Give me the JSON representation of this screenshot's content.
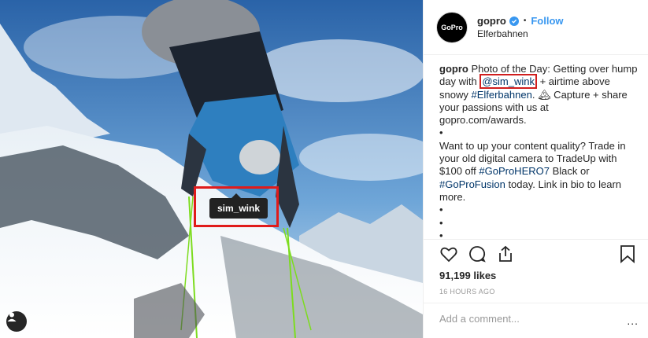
{
  "header": {
    "avatar_text": "GoPro",
    "username": "gopro",
    "dot": "•",
    "follow_label": "Follow",
    "location": "Elferbahnen"
  },
  "caption": {
    "username": "gopro",
    "t1": " Photo of the Day: Getting over hump day with ",
    "mention": "@sim_wink",
    "t2": " + airtime above snowy ",
    "hashtag1": "#Elferbahnen",
    "t3": ". ",
    "emoji": "🏔",
    "t4": " Capture + share your passions with us at gopro.com/awards.",
    "bullet": "•",
    "t5": "Want to up your content quality? Trade in your old digital camera to TradeUp with $100 off ",
    "hashtag2": "#GoProHERO7",
    "t6": " Black or ",
    "hashtag3": "#GoProFusion",
    "t7": " today. Link in bio to learn more."
  },
  "photo": {
    "tag_label": "sim_wink"
  },
  "stats": {
    "likes": "91,199 likes",
    "time": "16 HOURS AGO"
  },
  "comment": {
    "placeholder": "Add a comment...",
    "more": "..."
  },
  "colors": {
    "accent": "#3897f0",
    "highlight_box": "#d01e1e"
  }
}
